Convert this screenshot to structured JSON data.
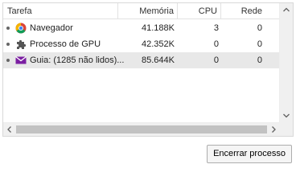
{
  "columns": {
    "task": "Tarefa",
    "memory": "Memória",
    "cpu": "CPU",
    "network": "Rede"
  },
  "rows": [
    {
      "icon": "chrome-browser-icon",
      "task": "Navegador",
      "memory": "41.188K",
      "cpu": "3",
      "network": "0",
      "selected": false
    },
    {
      "icon": "puzzle-piece-icon",
      "task": "Processo de GPU",
      "memory": "42.352K",
      "cpu": "0",
      "network": "0",
      "selected": false
    },
    {
      "icon": "mail-envelope-icon",
      "task": "Guia: (1285 não lidos)...",
      "memory": "85.644K",
      "cpu": "0",
      "network": "0",
      "selected": true
    }
  ],
  "buttons": {
    "end_process": "Encerrar processo"
  },
  "colors": {
    "selected_row": "#e8e8e8",
    "mail_icon": "#7b1fa2"
  }
}
